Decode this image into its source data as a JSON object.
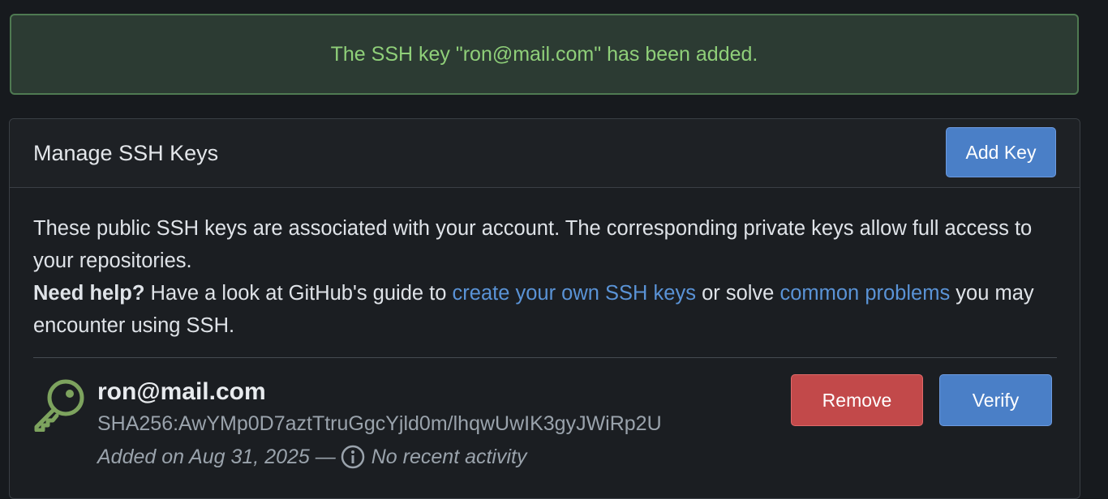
{
  "flash": {
    "message": "The SSH key \"ron@mail.com\" has been added."
  },
  "panel": {
    "title": "Manage SSH Keys",
    "add_key_label": "Add Key",
    "description": {
      "line1": "These public SSH keys are associated with your account. The corresponding private keys allow full access to your repositories.",
      "help_label": "Need help?",
      "help_text_a": " Have a look at GitHub's guide to ",
      "link1": "create your own SSH keys",
      "help_text_b": " or solve ",
      "link2": "common problems",
      "help_text_c": " you may encounter using SSH."
    },
    "keys": [
      {
        "name": "ron@mail.com",
        "fingerprint": "SHA256:AwYMp0D7aztTtruGgcYjld0m/lhqwUwIK3gyJWiRp2U",
        "added": "Added on Aug 31, 2025 —",
        "activity": "No recent activity",
        "remove_label": "Remove",
        "verify_label": "Verify",
        "icon": "key-icon"
      }
    ]
  },
  "colors": {
    "flash_bg": "#2c3b33",
    "flash_text": "#8fcf79",
    "link": "#5a93d6",
    "primary_button": "#4a7fc7",
    "danger_button": "#c2494a",
    "key_icon": "#7da35e"
  }
}
